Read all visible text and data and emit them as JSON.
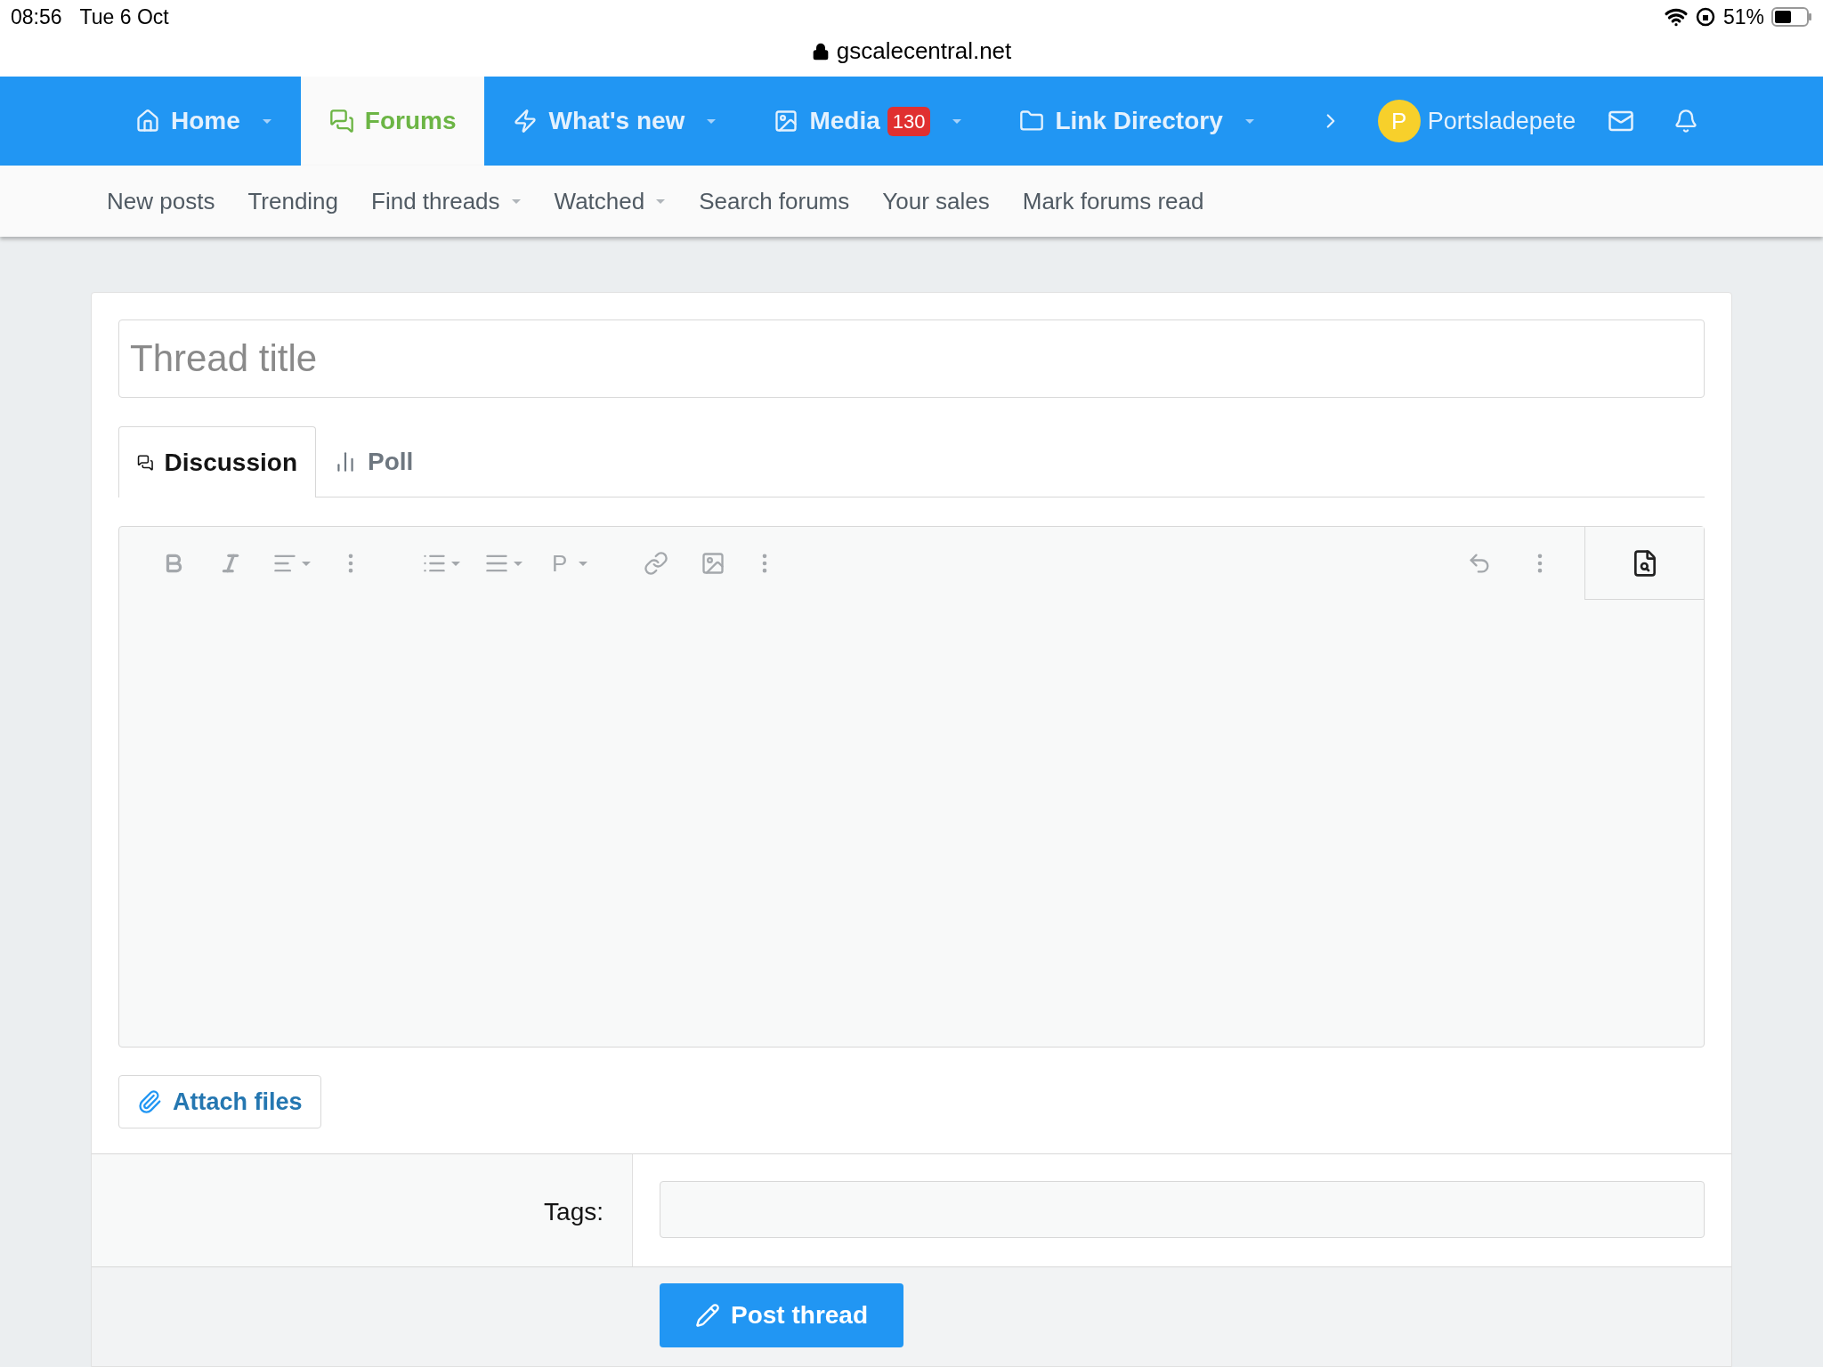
{
  "status_bar": {
    "time": "08:56",
    "date": "Tue 6 Oct",
    "url": "gscalecentral.net",
    "battery": "51%"
  },
  "nav": {
    "items": [
      {
        "kind": "home",
        "label": "Home",
        "selected": false,
        "has_menu": true
      },
      {
        "kind": "forums",
        "label": "Forums",
        "selected": true,
        "has_menu": false
      },
      {
        "kind": "whats_new",
        "label": "What's new",
        "selected": false,
        "has_menu": true
      },
      {
        "kind": "media",
        "label": "Media",
        "selected": false,
        "has_menu": true,
        "badge": "130"
      },
      {
        "kind": "folder",
        "label": "Link Directory",
        "selected": false,
        "has_menu": true
      }
    ],
    "user": {
      "avatar_letter": "P",
      "name": "Portsladepete"
    }
  },
  "subnav": [
    {
      "label": "New posts",
      "has_menu": false
    },
    {
      "label": "Trending",
      "has_menu": false
    },
    {
      "label": "Find threads",
      "has_menu": true
    },
    {
      "label": "Watched",
      "has_menu": true
    },
    {
      "label": "Search forums",
      "has_menu": false
    },
    {
      "label": "Your sales",
      "has_menu": false
    },
    {
      "label": "Mark forums read",
      "has_menu": false
    }
  ],
  "form": {
    "title_placeholder": "Thread title",
    "tabs": [
      {
        "kind": "discussion",
        "label": "Discussion",
        "selected": true
      },
      {
        "kind": "poll",
        "label": "Poll",
        "selected": false
      }
    ],
    "editor": {
      "paragraph_label": "P"
    },
    "attach_label": "Attach files",
    "tags": {
      "label": "Tags:"
    },
    "submit_label": "Post thread"
  }
}
